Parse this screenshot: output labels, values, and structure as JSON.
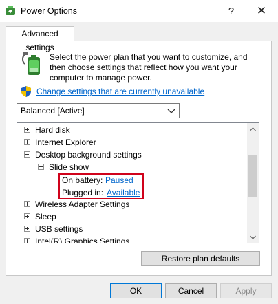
{
  "window": {
    "title": "Power Options",
    "help_glyph": "?",
    "close_glyph": "✕"
  },
  "tab": {
    "label": "Advanced settings"
  },
  "intro_text": "Select the power plan that you want to customize, and then choose settings that reflect how you want your computer to manage power.",
  "change_link": "Change settings that are currently unavailable",
  "plan_dropdown": {
    "value": "Balanced [Active]"
  },
  "tree": {
    "items": [
      {
        "label": "Hard disk"
      },
      {
        "label": "Internet Explorer"
      },
      {
        "label": "Desktop background settings"
      },
      {
        "label": "Slide show"
      },
      {
        "label": "On battery:",
        "value": "Paused"
      },
      {
        "label": "Plugged in:",
        "value": "Available"
      },
      {
        "label": "Wireless Adapter Settings"
      },
      {
        "label": "Sleep"
      },
      {
        "label": "USB settings"
      },
      {
        "label": "Intel(R) Graphics Settings"
      }
    ]
  },
  "buttons": {
    "restore": "Restore plan defaults",
    "ok": "OK",
    "cancel": "Cancel",
    "apply": "Apply"
  },
  "colors": {
    "link": "#0066cc",
    "highlight_border": "#d0021b",
    "default_button_border": "#0078d7"
  }
}
